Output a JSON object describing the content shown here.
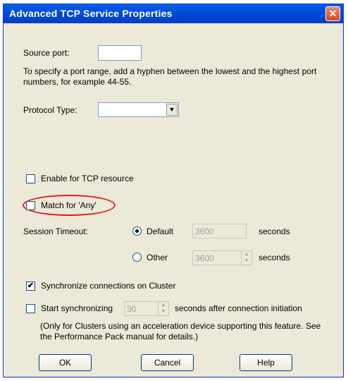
{
  "window": {
    "title": "Advanced TCP Service Properties",
    "close_glyph": "✕"
  },
  "source_port": {
    "label": "Source port:",
    "value": ""
  },
  "help_text": "To specify a port range, add a hyphen between the lowest and the highest port numbers, for example 44-55.",
  "protocol_type": {
    "label": "Protocol Type:",
    "value": "",
    "arrow_glyph": "▼"
  },
  "enable_tcp_resource": {
    "label": "Enable for TCP resource",
    "checked": false
  },
  "match_for_any": {
    "label": "Match for 'Any'",
    "checked": false
  },
  "session_timeout": {
    "label": "Session Timeout:",
    "default_label": "Default",
    "default_value": "3600",
    "other_label": "Other",
    "other_value": "3600",
    "unit": "seconds",
    "selected": "Default"
  },
  "sync_cluster": {
    "label": "Synchronize connections on Cluster",
    "checked": true,
    "check_glyph": "✔"
  },
  "start_sync": {
    "label": "Start synchronizing",
    "value": "30",
    "suffix": "seconds after connection initiation",
    "checked": false
  },
  "note": "(Only for Clusters using an acceleration device supporting this feature. See the Performance Pack manual for details.)",
  "buttons": {
    "ok": "OK",
    "cancel": "Cancel",
    "help": "Help"
  },
  "colors": {
    "titlebar": "#0054e3",
    "dialog_bg": "#ece9d8",
    "highlight_ring": "#e02020"
  }
}
